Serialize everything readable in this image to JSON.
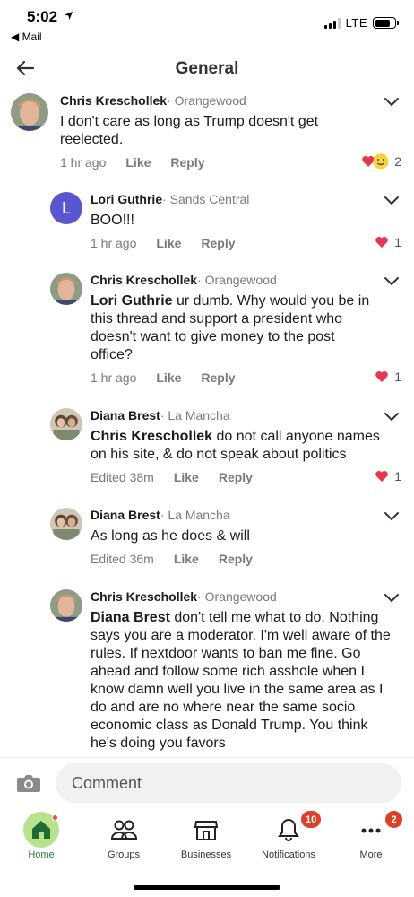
{
  "status_bar": {
    "time": "5:02",
    "back_app": "◀ Mail",
    "network": "LTE"
  },
  "header": {
    "title": "General"
  },
  "comments": [
    {
      "name": "Chris Kreschollek",
      "neighborhood": "· Orangewood",
      "mention": "",
      "text": "I don't care as long as Trump doesn't get reelected.",
      "time": "1 hr ago",
      "like": "Like",
      "reply": "Reply",
      "reaction_count": "2"
    },
    {
      "name": "Lori Guthrie",
      "neighborhood": "· Sands Central",
      "avatar_letter": "L",
      "mention": "",
      "text": "BOO!!!",
      "time": "1 hr ago",
      "like": "Like",
      "reply": "Reply",
      "reaction_count": "1"
    },
    {
      "name": "Chris Kreschollek",
      "neighborhood": "· Orangewood",
      "mention": "Lori Guthrie",
      "text": " ur dumb. Why would you be in this thread and support a president who doesn't want to give money to the post office?",
      "time": "1 hr ago",
      "like": "Like",
      "reply": "Reply",
      "reaction_count": "1"
    },
    {
      "name": "Diana Brest",
      "neighborhood": "· La Mancha",
      "mention": "Chris Kreschollek",
      "text": " do not call anyone names on his site, & do not speak about politics",
      "time": "Edited 38m",
      "like": "Like",
      "reply": "Reply",
      "reaction_count": "1"
    },
    {
      "name": "Diana Brest",
      "neighborhood": "· La Mancha",
      "mention": "",
      "text": "As long as he does & will",
      "time": "Edited 36m",
      "like": "Like",
      "reply": "Reply",
      "reaction_count": ""
    },
    {
      "name": "Chris Kreschollek",
      "neighborhood": "· Orangewood",
      "mention": "Diana Brest",
      "text": " don't tell me what to do. Nothing says you are a moderator. I'm well aware of the rules. If nextdoor wants to ban me fine. Go ahead and follow some rich asshole when I know damn well you live in the same area as I do and are no where near the same socio economic class as Donald Trump. You think he's doing you favors",
      "time": "",
      "like": "",
      "reply": "",
      "reaction_count": ""
    }
  ],
  "composer": {
    "placeholder": "Comment"
  },
  "tabs": [
    {
      "label": "Home",
      "badge": ""
    },
    {
      "label": "Groups",
      "badge": ""
    },
    {
      "label": "Businesses",
      "badge": ""
    },
    {
      "label": "Notifications",
      "badge": "10"
    },
    {
      "label": "More",
      "badge": "2"
    }
  ],
  "colors": {
    "accent_green": "#b9e28c",
    "badge_red": "#d9412b",
    "heart_red": "#e5384f"
  }
}
